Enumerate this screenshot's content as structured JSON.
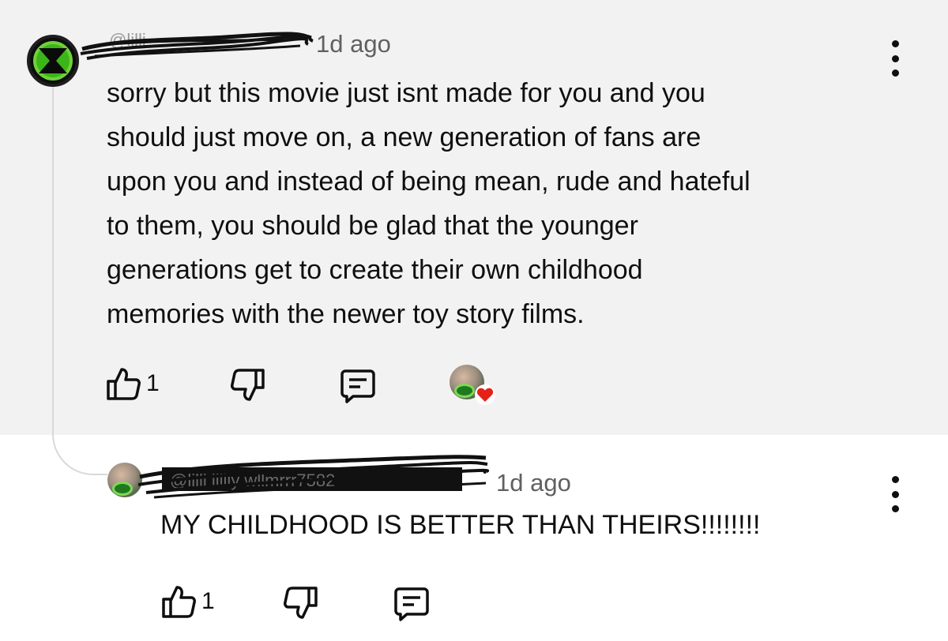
{
  "parent": {
    "timestamp": "1d ago",
    "text": "sorry but this movie just isnt made for you and you\nshould just move on, a new generation of fans are\nupon you and instead of being mean, rude and hateful\nto them, you should be glad that the younger\ngenerations  get to create their own childhood\nmemories with the newer toy story films.",
    "like_count": "1",
    "avatar_icon": "omnitrix-icon",
    "heart_color": "#e62117"
  },
  "reply": {
    "timestamp": "1d ago",
    "text": "MY CHILDHOOD IS BETTER THAN THEIRS!!!!!!!!",
    "like_count": "1"
  }
}
